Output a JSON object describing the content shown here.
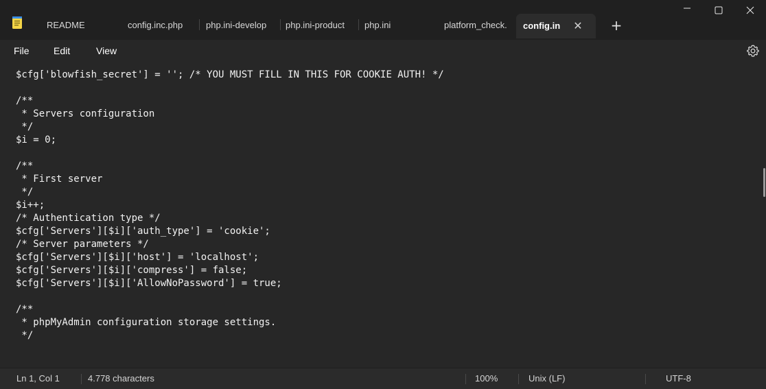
{
  "tabs": [
    {
      "label": "README"
    },
    {
      "label": "config.inc.php"
    },
    {
      "label": "php.ini-develop"
    },
    {
      "label": "php.ini-product"
    },
    {
      "label": "php.ini"
    },
    {
      "label": "platform_check."
    },
    {
      "label": "config.in",
      "active": true
    }
  ],
  "icons": {
    "close_tab": "✕",
    "new_tab": "+"
  },
  "menu": {
    "file": "File",
    "edit": "Edit",
    "view": "View"
  },
  "editor": {
    "lines": [
      "$cfg['blowfish_secret'] = ''; /* YOU MUST FILL IN THIS FOR COOKIE AUTH! */",
      "",
      "/**",
      " * Servers configuration",
      " */",
      "$i = 0;",
      "",
      "/**",
      " * First server",
      " */",
      "$i++;",
      "/* Authentication type */",
      "$cfg['Servers'][$i]['auth_type'] = 'cookie';",
      "/* Server parameters */",
      "$cfg['Servers'][$i]['host'] = 'localhost';",
      "$cfg['Servers'][$i]['compress'] = false;",
      "$cfg['Servers'][$i]['AllowNoPassword'] = true;",
      "",
      "/**",
      " * phpMyAdmin configuration storage settings.",
      " */"
    ]
  },
  "status": {
    "position": "Ln 1, Col 1",
    "characters": "4.778 characters",
    "zoom": "100%",
    "line_ending": "Unix (LF)",
    "encoding": "UTF-8"
  },
  "colors": {
    "titlebar": "#202020",
    "editor_bg": "#272727",
    "active_tab": "#2c2c2c",
    "text": "#f2f2f2",
    "app_icon": "#f5d547"
  }
}
